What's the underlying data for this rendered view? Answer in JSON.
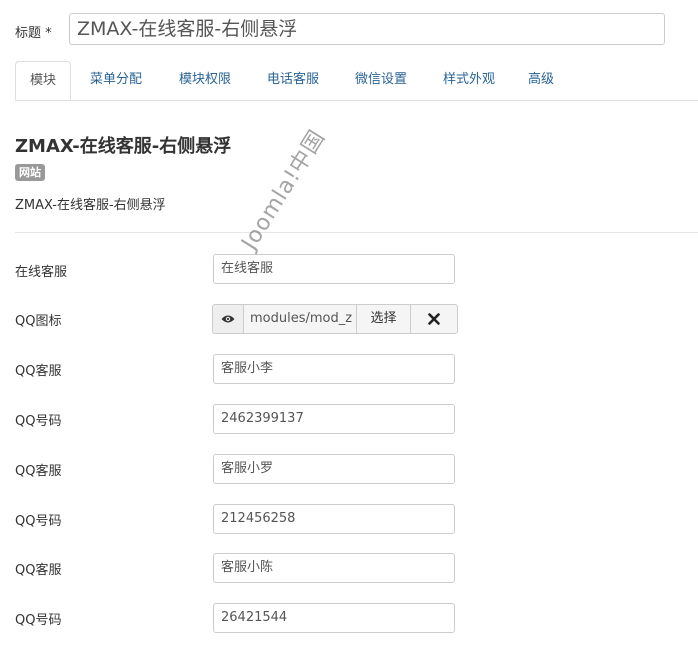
{
  "title_field": {
    "label": "标题 *",
    "value": "ZMAX-在线客服-右侧悬浮"
  },
  "tabs": [
    {
      "label": "模块",
      "active": true
    },
    {
      "label": "菜单分配"
    },
    {
      "label": "模块权限"
    },
    {
      "label": "电话客服"
    },
    {
      "label": "微信设置"
    },
    {
      "label": "样式外观"
    },
    {
      "label": "高级"
    }
  ],
  "module": {
    "title": "ZMAX-在线客服-右侧悬浮",
    "badge": "网站",
    "description": "ZMAX-在线客服-右侧悬浮"
  },
  "watermark": "Joomla!中国",
  "fields": [
    {
      "label": "在线客服",
      "value": "在线客服"
    },
    {
      "label": "QQ图标",
      "path": "modules/mod_z",
      "select_label": "选择",
      "preview_icon": "eye-icon",
      "clear_icon": "close-icon"
    },
    {
      "label": "QQ客服",
      "value": "客服小李"
    },
    {
      "label": "QQ号码",
      "value": "2462399137"
    },
    {
      "label": "QQ客服",
      "value": "客服小罗"
    },
    {
      "label": "QQ号码",
      "value": "212456258"
    },
    {
      "label": "QQ客服",
      "value": "客服小陈"
    },
    {
      "label": "QQ号码",
      "value": "26421544"
    }
  ],
  "colors": {
    "tab_link": "#2a6496",
    "badge_bg": "#999999",
    "border": "#cccccc"
  }
}
